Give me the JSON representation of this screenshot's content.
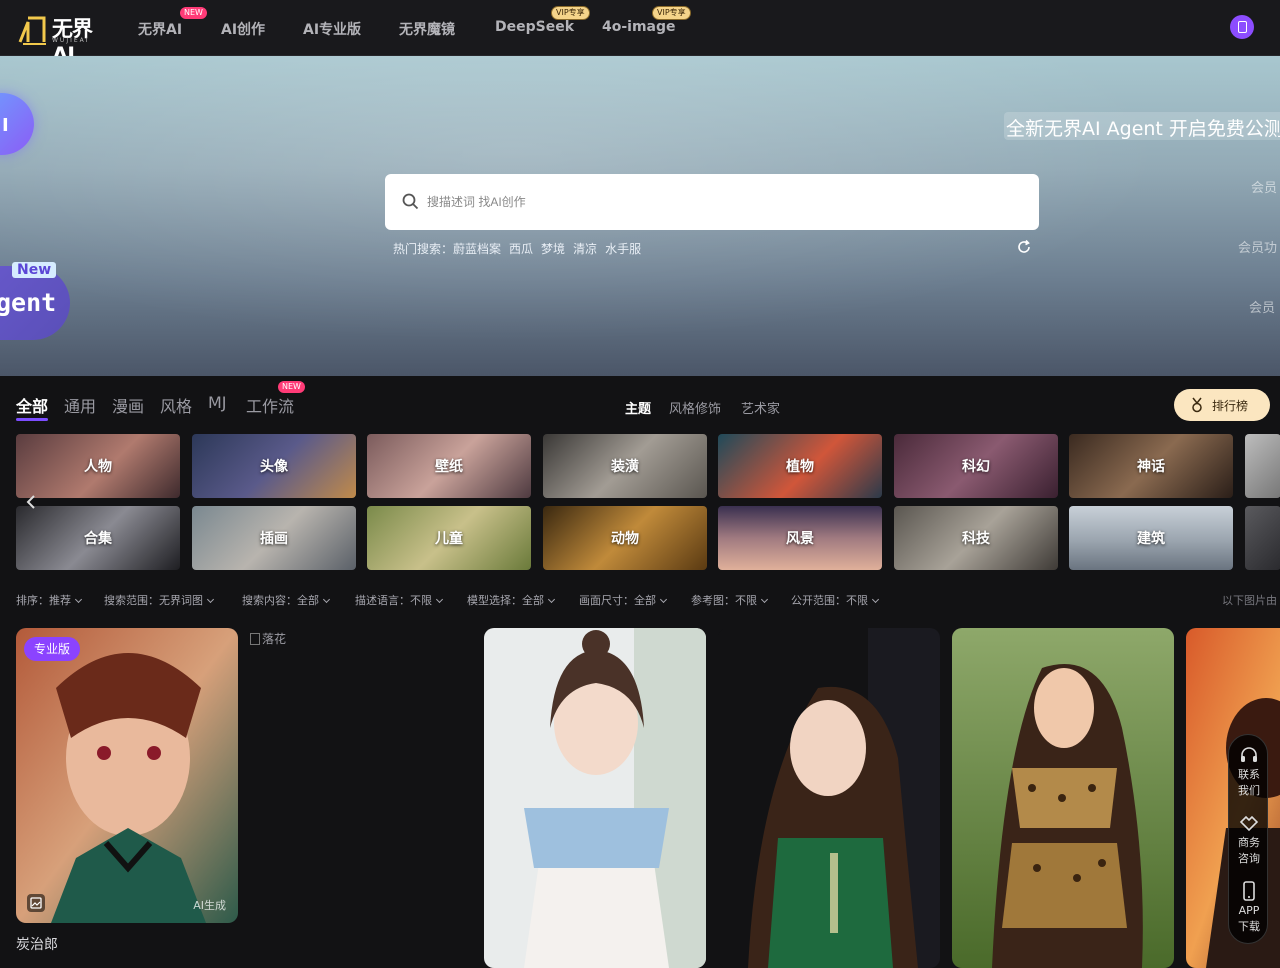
{
  "brand": {
    "logo_text": "无界AI",
    "logo_sub": "WUJIEAI"
  },
  "nav": {
    "items": [
      {
        "label": "无界AI",
        "badge": "NEW"
      },
      {
        "label": "AI创作",
        "badge": ""
      },
      {
        "label": "AI专业版",
        "badge": ""
      },
      {
        "label": "无界魔镜",
        "badge": ""
      },
      {
        "label": "DeepSeek",
        "badge": "VIP专享"
      },
      {
        "label": "4o-image",
        "badge": "VIP专享"
      }
    ],
    "user_icon": "user-phone-icon"
  },
  "hero": {
    "blob1_text": "I",
    "blob2_badge": "New",
    "blob2_text": "gent",
    "marquee": "全新无界AI Agent 开启免费公测",
    "side_lines": [
      "会员",
      "会员功",
      "会员"
    ],
    "search": {
      "placeholder": "搜描述词 找AI创作",
      "hot_label": "热门搜索：",
      "hot_tags": [
        "蔚蓝档案",
        "西瓜",
        "梦境",
        "清凉",
        "水手服"
      ]
    }
  },
  "tabs": {
    "main": [
      "全部",
      "通用",
      "漫画",
      "风格",
      "MJ",
      "工作流"
    ],
    "main_active": "全部",
    "workflow_badge": "NEW",
    "sub": [
      "主题",
      "风格修饰",
      "艺术家"
    ],
    "sub_active": "主题",
    "rank_button": "排行榜"
  },
  "tiles": {
    "row1": [
      "人物",
      "头像",
      "壁纸",
      "装潢",
      "植物",
      "科幻",
      "神话"
    ],
    "row2": [
      "合集",
      "插画",
      "儿童",
      "动物",
      "风景",
      "科技",
      "建筑"
    ]
  },
  "filters": [
    {
      "label": "排序：推荐"
    },
    {
      "label": "搜索范围：无界词图"
    },
    {
      "label": "搜索内容：全部"
    },
    {
      "label": "描述语言：不限"
    },
    {
      "label": "模型选择：全部"
    },
    {
      "label": "画面尺寸：全部"
    },
    {
      "label": "参考图：不限"
    },
    {
      "label": "公开范围：不限"
    }
  ],
  "filters_right": "以下图片由",
  "gallery": {
    "card1": {
      "badge": "专业版",
      "ai_label": "AI生成",
      "title": "炭治郎"
    },
    "broken_alt": "落花"
  },
  "float_bar": {
    "contact": "联系我们",
    "business": "商务咨询",
    "app": "APP下载"
  },
  "colors": {
    "accent": "#7c4dff",
    "badge_new": "#ff3b77",
    "vip": "#f5d48a",
    "bg": "#121214"
  }
}
